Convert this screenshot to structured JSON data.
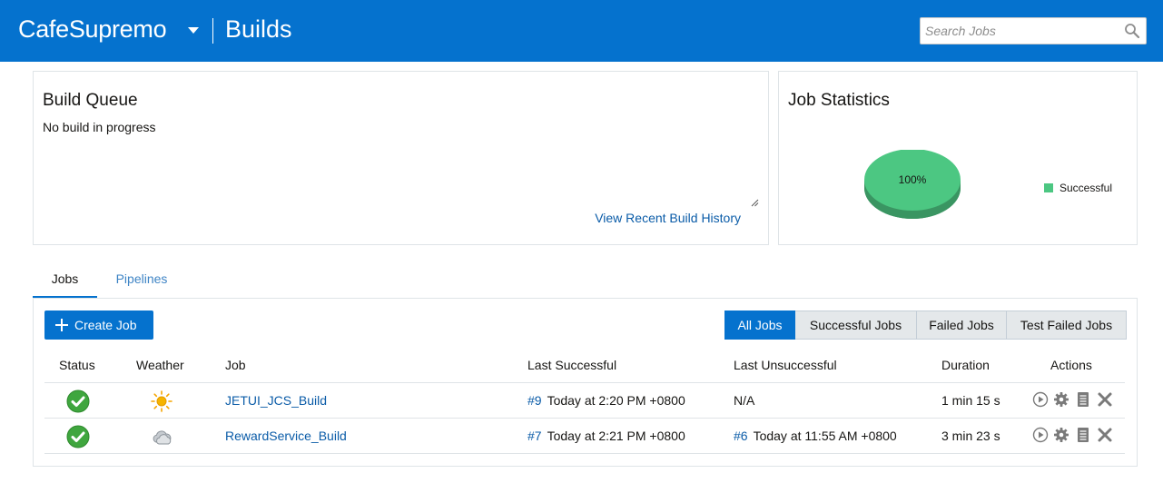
{
  "header": {
    "project": "CafeSupremo",
    "section": "Builds",
    "search_placeholder": "Search Jobs"
  },
  "build_queue": {
    "title": "Build Queue",
    "message": "No build in progress",
    "history_link": "View Recent Build History"
  },
  "job_statistics": {
    "title": "Job Statistics",
    "pie_label": "100%",
    "legend": "Successful",
    "successful_fraction": 1.0,
    "color": "#4cc782"
  },
  "tabs": [
    "Jobs",
    "Pipelines"
  ],
  "jobs_panel": {
    "create_label": "Create Job",
    "filters": [
      "All Jobs",
      "Successful Jobs",
      "Failed Jobs",
      "Test Failed Jobs"
    ],
    "active_filter": "All Jobs",
    "columns": [
      "Status",
      "Weather",
      "Job",
      "Last Successful",
      "Last Unsuccessful",
      "Duration",
      "Actions"
    ],
    "rows": [
      {
        "status": "success",
        "weather": "sunny",
        "job": "JETUI_JCS_Build",
        "last_success_num": "#9",
        "last_success_time": "Today at 2:20 PM +0800",
        "last_fail_num": "",
        "last_fail_time": "N/A",
        "duration": "1 min 15 s"
      },
      {
        "status": "success",
        "weather": "cloudy",
        "job": "RewardService_Build",
        "last_success_num": "#7",
        "last_success_time": "Today at 2:21 PM +0800",
        "last_fail_num": "#6",
        "last_fail_time": "Today at 11:55 AM +0800",
        "duration": "3 min 23 s"
      }
    ]
  }
}
